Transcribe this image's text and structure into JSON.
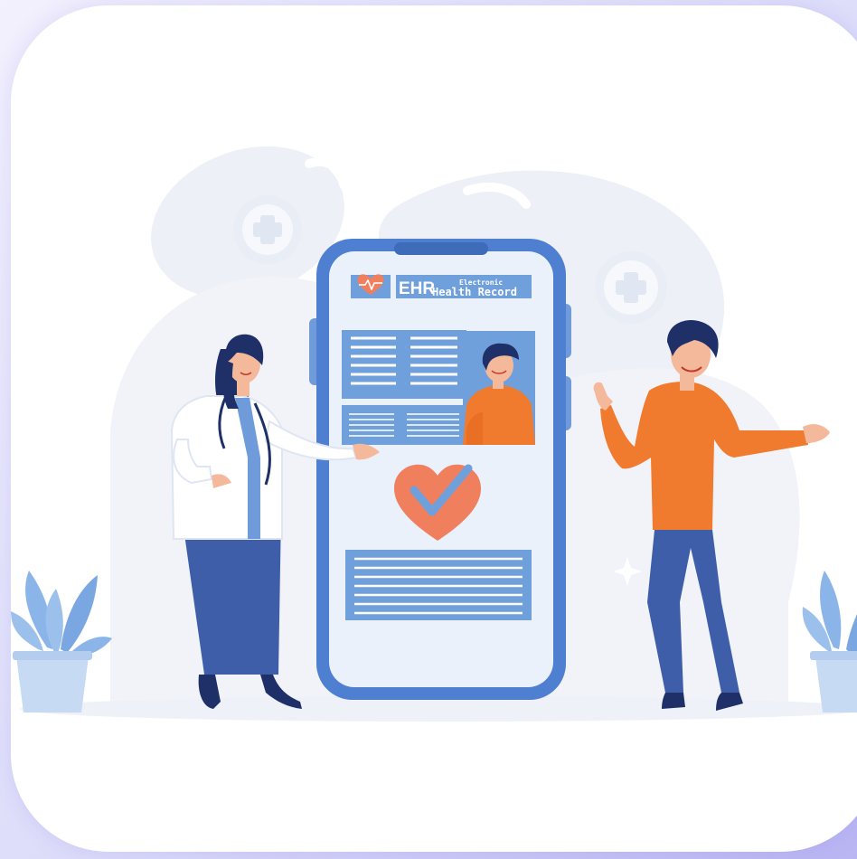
{
  "illustration": {
    "theme": "electronic health record app",
    "record_card": {
      "abbreviation": "EHR",
      "subtitle_line1": "Electronic",
      "subtitle_line2": "Health Record"
    },
    "colors": {
      "background_outer": "#dcdcfa",
      "card": "#ffffff",
      "blob": "#eef0f8",
      "phone_body": "#4e7fd0",
      "phone_screen": "#eaf1fb",
      "panel_blue": "#6fa0dc",
      "heart": "#f07f5e",
      "check": "#6fa0dc",
      "shirt_orange": "#f07b2e",
      "skirt_blue": "#3f5eaa",
      "coat_white": "#ffffff",
      "hair_navy": "#1f3069",
      "skin": "#f4b89a",
      "plant_leaf": "#8bb4e8",
      "pot": "#c6dbf3"
    },
    "icons": [
      "heart-pulse-icon",
      "heart-check-icon",
      "medical-cross-icon",
      "sparkle-icon"
    ]
  }
}
